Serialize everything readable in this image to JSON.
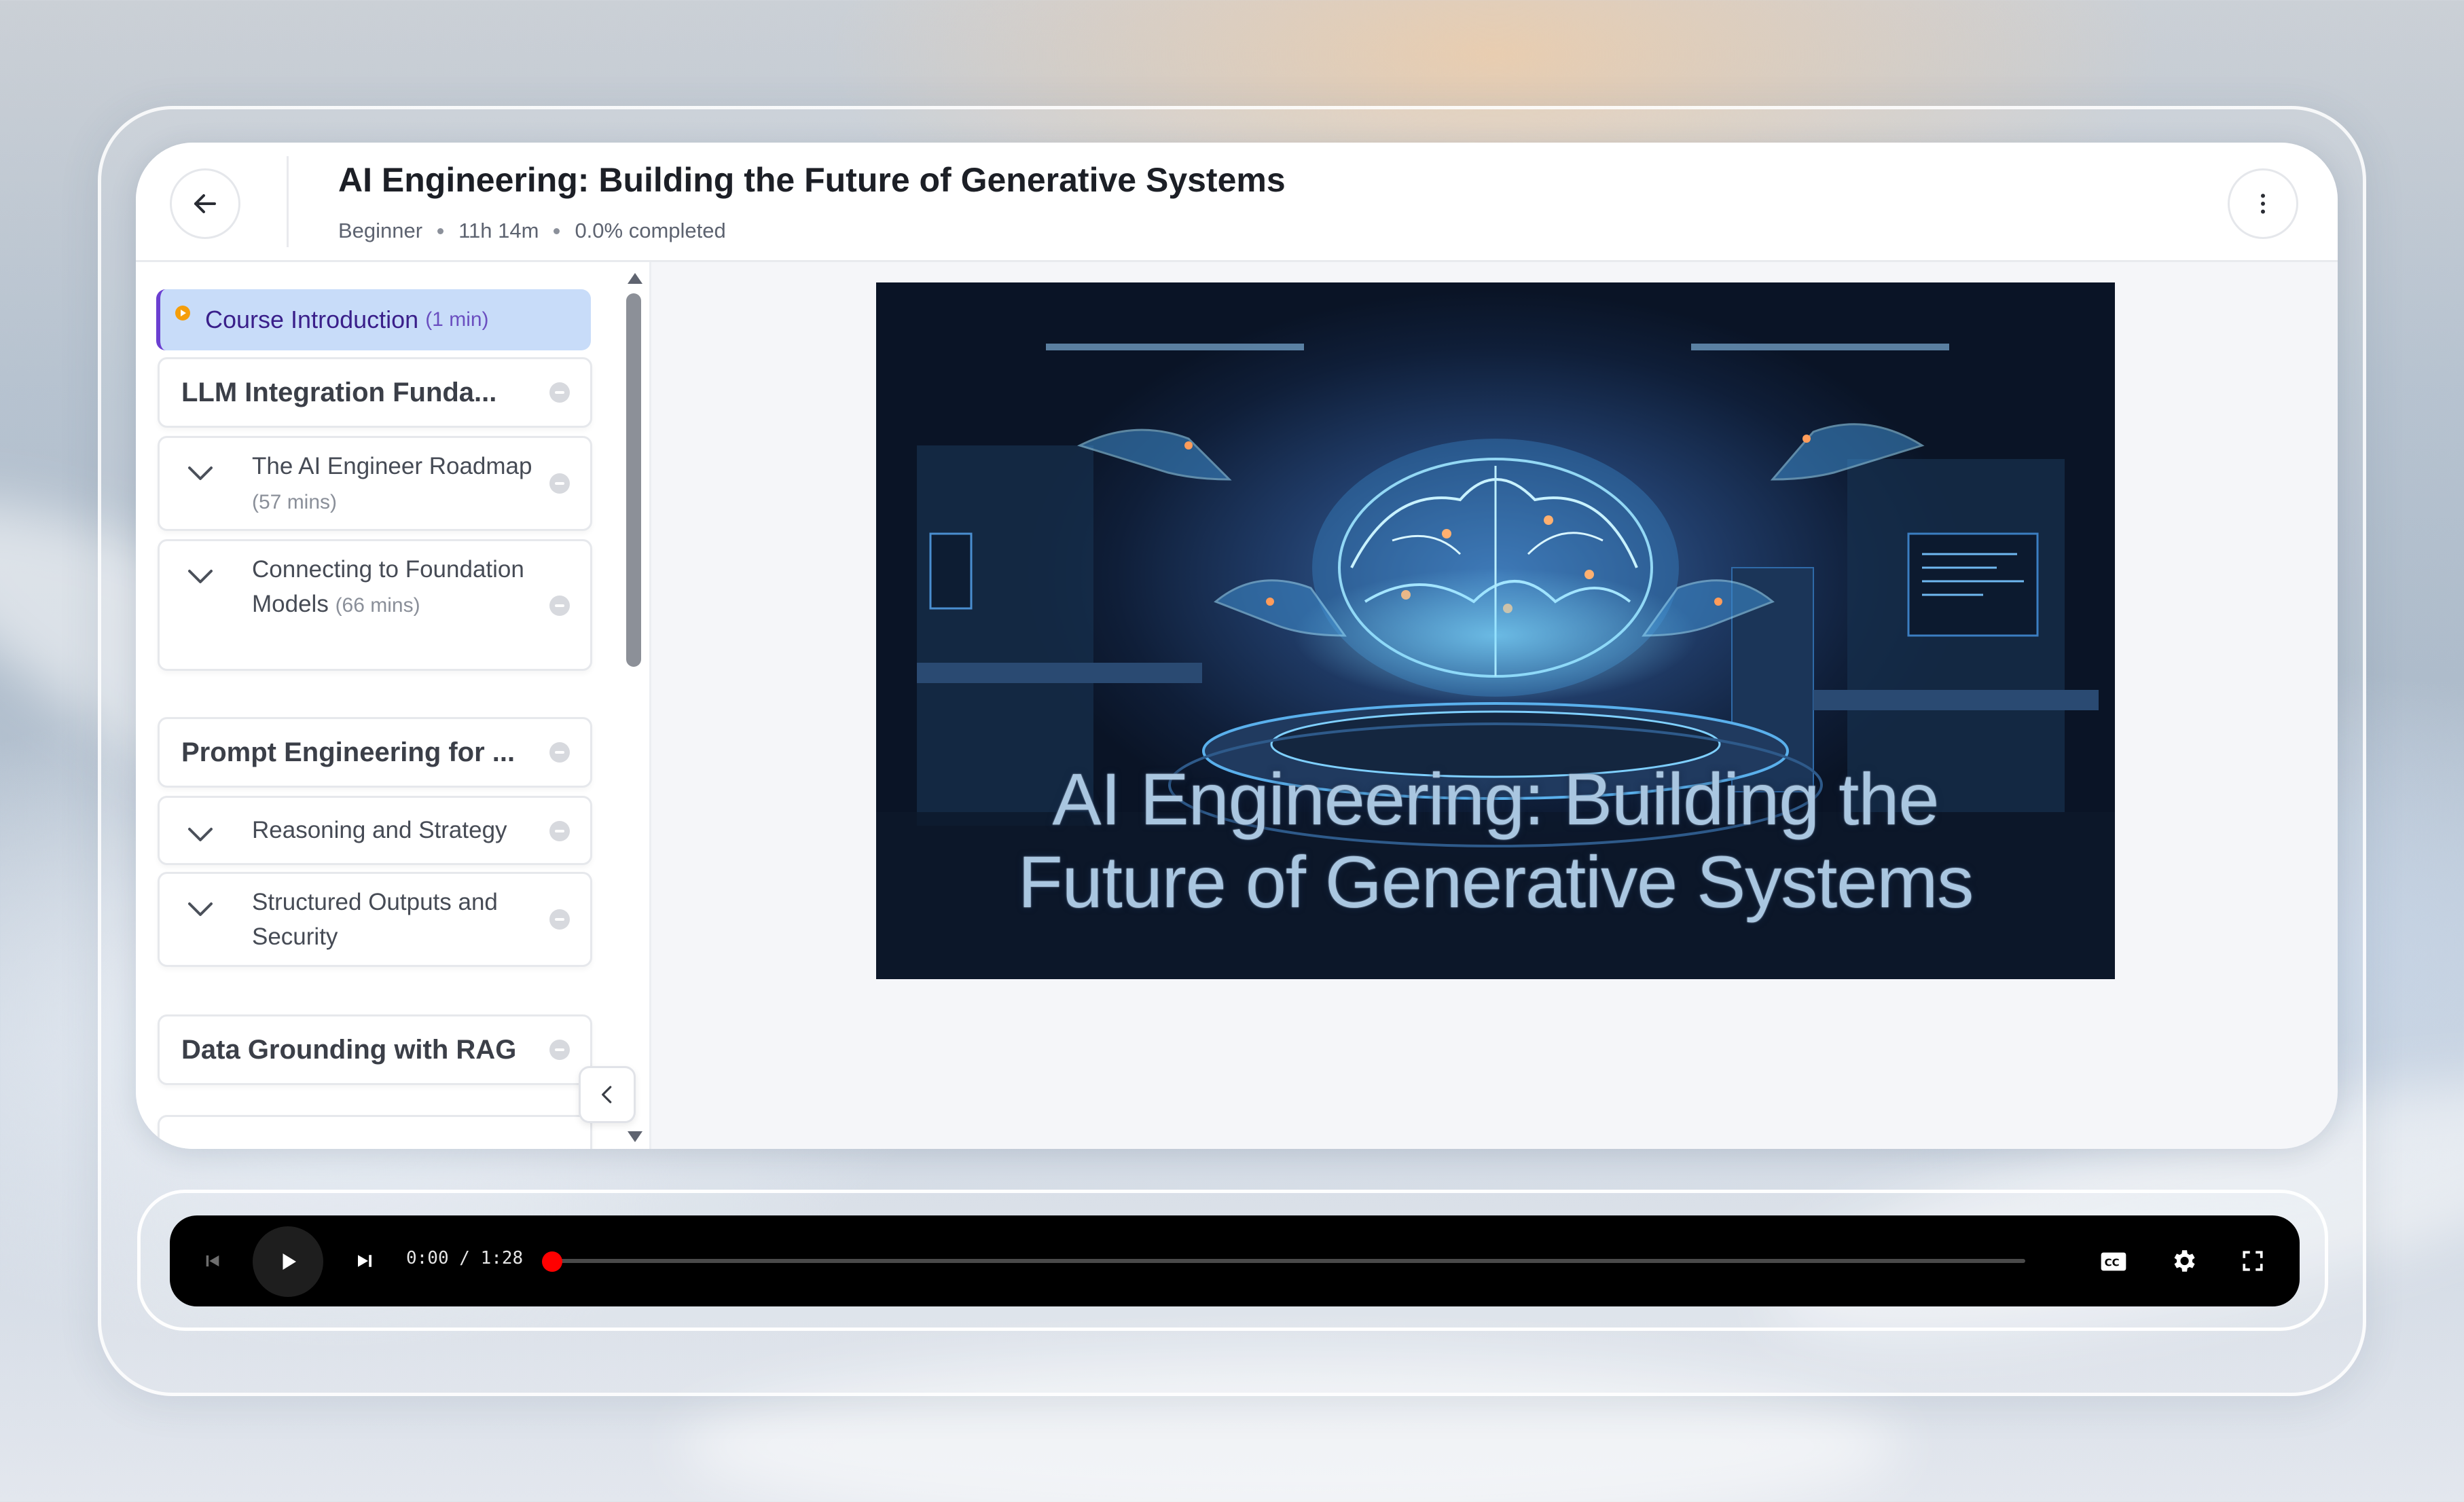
{
  "header": {
    "title": "AI Engineering: Building the Future of Generative Systems",
    "level": "Beginner",
    "duration": "11h 14m",
    "progress_text": "0.0% completed"
  },
  "sidebar": {
    "active_item": {
      "label": "Course Introduction",
      "duration": "(1 min)"
    },
    "sections": [
      {
        "label": "LLM Integration Funda..."
      },
      {
        "label": "Prompt Engineering for ..."
      },
      {
        "label": "Data Grounding with RAG"
      }
    ],
    "lessons": [
      {
        "label": "The AI Engineer Roadmap",
        "duration": "(57 mins)"
      },
      {
        "label": "Connecting to Foundation Models",
        "duration": "(66 mins)"
      },
      {
        "label": "Reasoning and Strategy",
        "duration": ""
      },
      {
        "label": "Structured Outputs and Security",
        "duration": ""
      }
    ]
  },
  "video": {
    "title_line1": "AI Engineering: Building the",
    "title_line2": "Future of Generative Systems"
  },
  "player": {
    "current_time": "0:00",
    "total_time": "1:28",
    "time_separator": "/",
    "progress": 0.0
  },
  "colors": {
    "accent": "#6b3fd1",
    "active_bg": "#c8dcf9",
    "play_indicator": "#f59e0b",
    "progress_red": "#ff0000"
  },
  "icons": [
    "arrow-left-icon",
    "more-vertical-icon",
    "play-indicator-icon",
    "chevron-down-icon",
    "minus-circle-icon",
    "chevron-left-icon",
    "skip-previous-icon",
    "play-icon",
    "skip-next-icon",
    "captions-icon",
    "gear-icon",
    "fullscreen-icon"
  ]
}
